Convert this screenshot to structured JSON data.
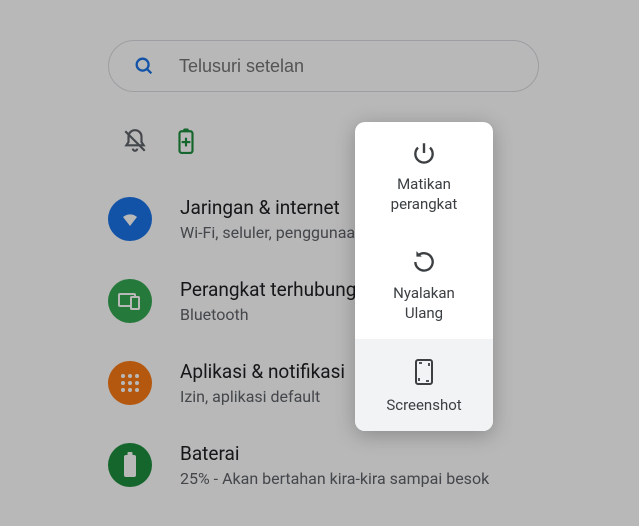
{
  "search": {
    "placeholder": "Telusuri setelan"
  },
  "settings": [
    {
      "title": "Jaringan & internet",
      "subtitle": "Wi-Fi, seluler, penggunaan data"
    },
    {
      "title": "Perangkat terhubung",
      "subtitle": "Bluetooth"
    },
    {
      "title": "Aplikasi & notifikasi",
      "subtitle": "Izin, aplikasi default"
    },
    {
      "title": "Baterai",
      "subtitle": "25% - Akan bertahan kira-kira sampai besok"
    }
  ],
  "power_menu": [
    {
      "label": "Matikan\nperangkat"
    },
    {
      "label": "Nyalakan\nUlang"
    },
    {
      "label": "Screenshot"
    }
  ],
  "colors": {
    "accent_blue": "#1a73e8",
    "accent_green": "#34a853",
    "accent_orange": "#fa7b17",
    "accent_teal": "#1e8e3e",
    "text_primary": "#202124",
    "text_secondary": "#5f6368"
  }
}
